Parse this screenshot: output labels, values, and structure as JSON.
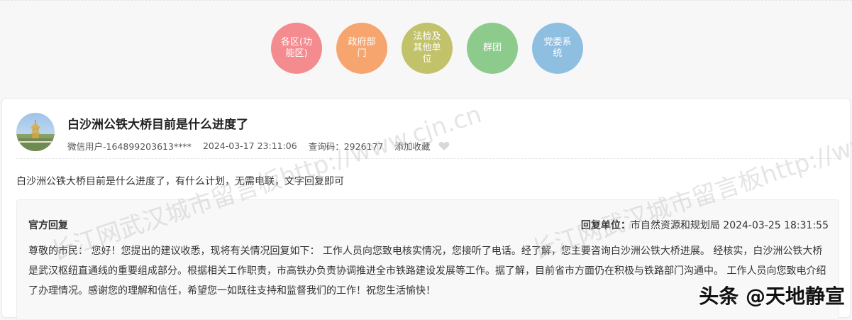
{
  "categories": [
    {
      "label": "各区(功能区)",
      "color": "#f38b8f"
    },
    {
      "label": "政府部门",
      "color": "#f7a56f"
    },
    {
      "label": "法检及其他单位",
      "color": "#c1c26a"
    },
    {
      "label": "群团",
      "color": "#8ccb8c"
    },
    {
      "label": "党委系统",
      "color": "#8fbfe0"
    }
  ],
  "post": {
    "title": "白沙洲公铁大桥目前是什么进度了",
    "user": "微信用户-164899203613****",
    "time": "2024-03-17 23:11:06",
    "query_code": "查询码：2926177",
    "favorite": "添加收藏",
    "question": "白沙洲公铁大桥目前是什么进度了，有什么计划，无需电联，文字回复即可"
  },
  "reply": {
    "label": "官方回复",
    "unit_label": "回复单位：",
    "unit": "市自然资源和规划局",
    "time": "2024-03-25 18:31:55",
    "body": "尊敬的市民： 您好！您提出的建议收悉，现将有关情况回复如下： 工作人员向您致电核实情况，您接听了电话。经了解，您主要咨询白沙洲公铁大桥进展。 经核实，白沙洲公铁大桥是武汉枢纽直通线的重要组成部分。根据相关工作职责，市高铁办负责协调推进全市铁路建设发展等工作。据了解，目前省市方面仍在积极与铁路部门沟通中。 工作人员向您致电介绍了办理情况。感谢您的理解和信任，希望您一如既往支持和监督我们的工作！祝您生活愉快！"
  },
  "watermarks": [
    "长江网武汉城市留言板http://www.cjn.cn",
    "长江网武汉城市留言板http://www.cjn.cn"
  ],
  "corner_mark": "头条 @天地静宣"
}
